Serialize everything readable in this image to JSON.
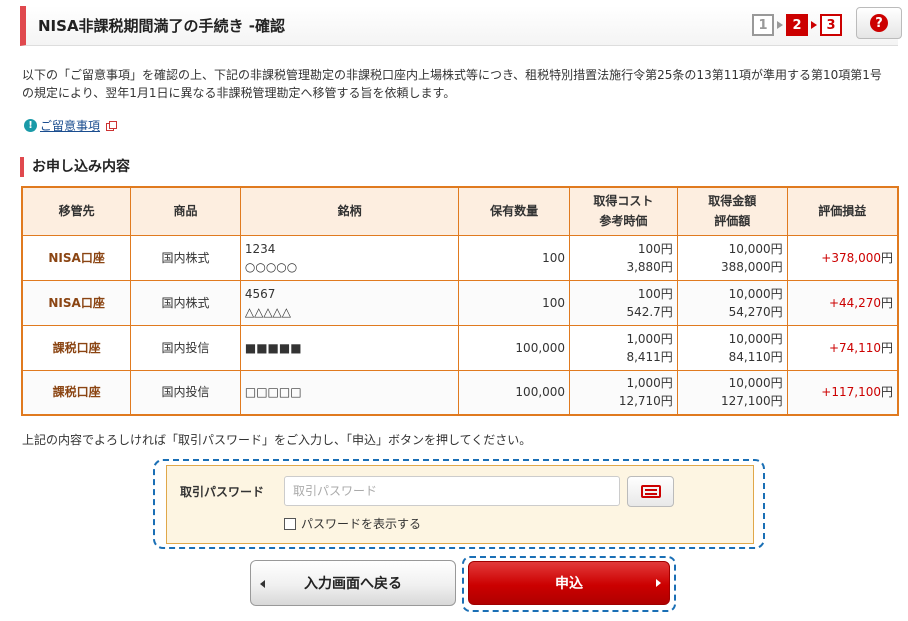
{
  "header": {
    "title": "NISA非課税期間満了の手続き -確認",
    "steps": [
      "1",
      "2",
      "3"
    ],
    "help_label": "?"
  },
  "intro": "以下の「ご留意事項」を確認の上、下記の非課税管理勘定の非課税口座内上場株式等につき、租税特別措置法施行令第25条の13第11項が準用する第10項第1号の規定により、翌年1月1日に異なる非課税管理勘定へ移管する旨を依頼します。",
  "notice": {
    "icon": "!",
    "link_label": "ご留意事項"
  },
  "section_title": "お申し込み内容",
  "table": {
    "headers": {
      "dest": "移管先",
      "product": "商品",
      "name": "銘柄",
      "qty": "保有数量",
      "cost_1": "取得コスト",
      "cost_2": "参考時価",
      "amount_1": "取得金額",
      "amount_2": "評価額",
      "gain": "評価損益"
    },
    "rows": [
      {
        "dest": "NISA口座",
        "product": "国内株式",
        "code": "1234",
        "name": "○○○○○",
        "qty": "100",
        "cost": "100円",
        "price": "3,880円",
        "acq": "10,000円",
        "value": "388,000円",
        "gain": "+378,000",
        "unit": "円"
      },
      {
        "dest": "NISA口座",
        "product": "国内株式",
        "code": "4567",
        "name": "△△△△△",
        "qty": "100",
        "cost": "100円",
        "price": "542.7円",
        "acq": "10,000円",
        "value": "54,270円",
        "gain": "+44,270",
        "unit": "円"
      },
      {
        "dest": "課税口座",
        "product": "国内投信",
        "code": "",
        "name": "■■■■■",
        "qty": "100,000",
        "cost": "1,000円",
        "price": "8,411円",
        "acq": "10,000円",
        "value": "84,110円",
        "gain": "+74,110",
        "unit": "円"
      },
      {
        "dest": "課税口座",
        "product": "国内投信",
        "code": "",
        "name": "□□□□□",
        "qty": "100,000",
        "cost": "1,000円",
        "price": "12,710円",
        "acq": "10,000円",
        "value": "127,100円",
        "gain": "+117,100",
        "unit": "円"
      }
    ]
  },
  "confirm_text": "上記の内容でよろしければ「取引パスワード」をご入力し、「申込」ボタンを押してください。",
  "password": {
    "label": "取引パスワード",
    "placeholder": "取引パスワード",
    "value": "",
    "show_label": "パスワードを表示する",
    "show_checked": false
  },
  "buttons": {
    "back": "入力画面へ戻る",
    "submit": "申込"
  },
  "colors": {
    "accent": "#e0494e",
    "table_border": "#e07a1f",
    "submit": "#cc0000",
    "gain": "#cc0000"
  }
}
